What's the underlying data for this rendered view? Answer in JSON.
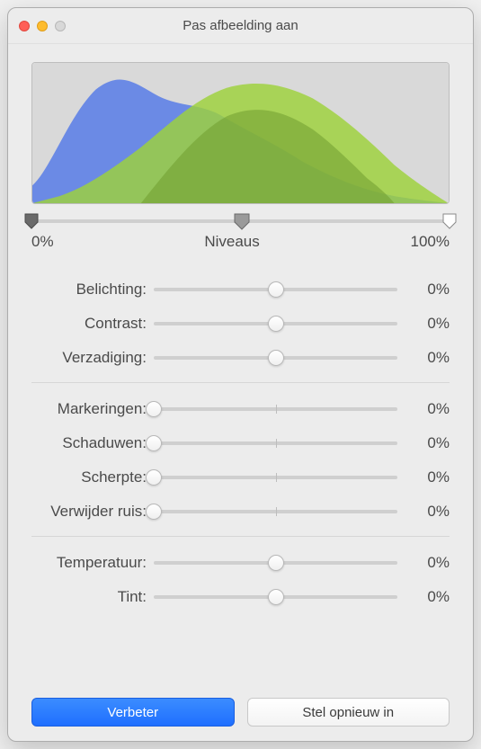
{
  "window": {
    "title": "Pas afbeelding aan"
  },
  "levels": {
    "left_label": "0%",
    "center_label": "Niveaus",
    "right_label": "100%",
    "handles": {
      "black": 0,
      "mid": 50,
      "white": 100
    }
  },
  "sliders": {
    "group1": [
      {
        "key": "exposure",
        "label": "Belichting:",
        "value": "0%",
        "pos": 50,
        "tick": false
      },
      {
        "key": "contrast",
        "label": "Contrast:",
        "value": "0%",
        "pos": 50,
        "tick": false
      },
      {
        "key": "saturation",
        "label": "Verzadiging:",
        "value": "0%",
        "pos": 50,
        "tick": false
      }
    ],
    "group2": [
      {
        "key": "highlights",
        "label": "Markeringen:",
        "value": "0%",
        "pos": 0,
        "tick": true
      },
      {
        "key": "shadows",
        "label": "Schaduwen:",
        "value": "0%",
        "pos": 0,
        "tick": true
      },
      {
        "key": "sharpness",
        "label": "Scherpte:",
        "value": "0%",
        "pos": 0,
        "tick": true
      },
      {
        "key": "denoise",
        "label": "Verwijder ruis:",
        "value": "0%",
        "pos": 0,
        "tick": true
      }
    ],
    "group3": [
      {
        "key": "temperature",
        "label": "Temperatuur:",
        "value": "0%",
        "pos": 50,
        "tick": false
      },
      {
        "key": "tint",
        "label": "Tint:",
        "value": "0%",
        "pos": 50,
        "tick": false
      }
    ]
  },
  "buttons": {
    "enhance": "Verbeter",
    "reset": "Stel opnieuw in"
  },
  "colors": {
    "accent": "#1f6fff",
    "hist_blue": "#5b7ee6",
    "hist_green": "#9ed23a",
    "hist_olive": "#6f9c2f"
  }
}
